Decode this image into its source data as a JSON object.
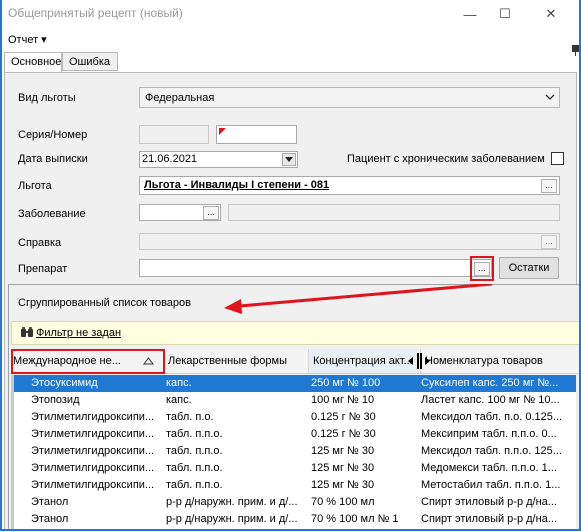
{
  "window": {
    "title": "Общепринятый рецепт (новый)",
    "minimize": "—",
    "maximize": "☐",
    "close": "✕"
  },
  "menu": {
    "report": "Отчет ▾"
  },
  "tabs": [
    "Основное",
    "Ошибка"
  ],
  "form": {
    "benefit_type_label": "Вид льготы",
    "benefit_type_value": "Федеральная",
    "series_label": "Серия/Номер",
    "date_label": "Дата выписки",
    "date_value": "21.06.2021",
    "chronic_label": "Пациент с хроническим заболеванием",
    "benefit_label": "Льгота",
    "benefit_value": "Льгота - Инвалиды I степени - 081",
    "disease_label": "Заболевание",
    "certificate_label": "Справка",
    "drug_label": "Препарат",
    "ellipsis": "...",
    "remains_button": "Остатки"
  },
  "popup": {
    "title": "Сгруппированный список товаров",
    "filter_label": "Фильтр не задан",
    "columns": [
      "Международное не...",
      "Лекарственные формы",
      "Концентрация акт...",
      "Номенклатура товаров"
    ],
    "rows": [
      [
        "Этосуксимид",
        "капс.",
        "250 мг № 100",
        "Суксилеп капс. 250 мг №..."
      ],
      [
        "Этопозид",
        "капс.",
        "100 мг № 10",
        "Ластет капс. 100 мг № 10..."
      ],
      [
        "Этилметилгидроксипи...",
        "табл. п.о.",
        "0.125 г № 30",
        "Мексидол табл. п.о. 0.125..."
      ],
      [
        "Этилметилгидроксипи...",
        "табл. п.п.о.",
        "0.125 г № 30",
        "Мексиприм табл. п.п.о. 0..."
      ],
      [
        "Этилметилгидроксипи...",
        "табл. п.п.о.",
        "125 мг № 30",
        "Мексидол табл. п.п.о. 125..."
      ],
      [
        "Этилметилгидроксипи...",
        "табл. п.п.о.",
        "125 мг № 30",
        "Медомекси табл. п.п.о. 1..."
      ],
      [
        "Этилметилгидроксипи...",
        "табл. п.п.о.",
        "125 мг № 30",
        "Метостабил табл. п.п.о. 1..."
      ],
      [
        "Этанол",
        "р-р д/наружн. прим. и д/...",
        "70 % 100 мл",
        "Спирт этиловый р-р д/на..."
      ],
      [
        "Этанол",
        "р-р д/наружн. прим. и д/...",
        "70 % 100 мл № 1",
        "Спирт этиловый р-р д/на..."
      ]
    ]
  },
  "colors": {
    "accent": "#e0141c",
    "selection": "#1f78d1",
    "filter_bg": "#ffffe1"
  }
}
